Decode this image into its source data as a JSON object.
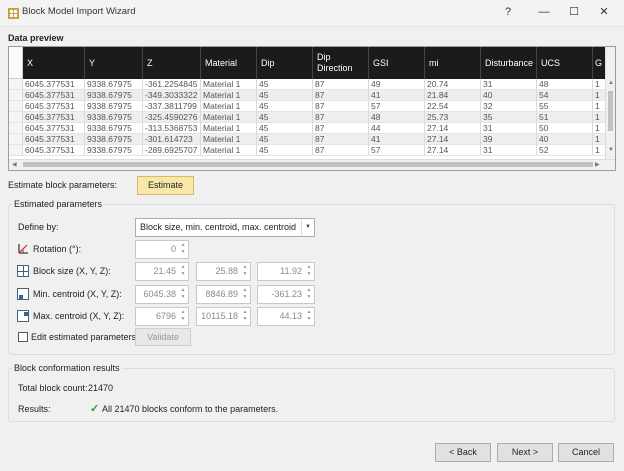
{
  "window": {
    "title": "Block Model Import Wizard",
    "help_btn": "?",
    "min_btn": "—",
    "max_btn": "☐",
    "close_btn": "✕"
  },
  "preview": {
    "title": "Data preview",
    "columns": [
      "X",
      "Y",
      "Z",
      "Material",
      "Dip",
      "Dip Direction",
      "GSI",
      "mi",
      "Disturbance",
      "UCS",
      "G"
    ],
    "rows": [
      [
        "6045.377531",
        "9338.67975",
        "-361.2254845",
        "Material 1",
        "45",
        "87",
        "49",
        "20.74",
        "31",
        "48",
        "1"
      ],
      [
        "6045.377531",
        "9338.67975",
        "-349.3033322",
        "Material 1",
        "45",
        "87",
        "41",
        "21.84",
        "40",
        "54",
        "1"
      ],
      [
        "6045.377531",
        "9338.67975",
        "-337.3811799",
        "Material 1",
        "45",
        "87",
        "57",
        "22.54",
        "32",
        "55",
        "1"
      ],
      [
        "6045.377531",
        "9338.67975",
        "-325.4590276",
        "Material 1",
        "45",
        "87",
        "48",
        "25.73",
        "35",
        "51",
        "1"
      ],
      [
        "6045.377531",
        "9338.67975",
        "-313.5368753",
        "Material 1",
        "45",
        "87",
        "44",
        "27.14",
        "31",
        "50",
        "1"
      ],
      [
        "6045.377531",
        "9338.67975",
        "-301.614723",
        "Material 1",
        "45",
        "87",
        "41",
        "27.14",
        "39",
        "40",
        "1"
      ],
      [
        "6045.377531",
        "9338.67975",
        "-289.6925707",
        "Material 1",
        "45",
        "87",
        "57",
        "27.14",
        "31",
        "52",
        "1"
      ]
    ]
  },
  "estimate": {
    "label": "Estimate block parameters:",
    "button": "Estimate"
  },
  "params": {
    "group_title": "Estimated parameters",
    "define_label": "Define by:",
    "define_value": "Block size, min. centroid, max. centroid",
    "rotation_label": "Rotation (°):",
    "rotation_value": "0",
    "block_size_label": "Block size (X, Y, Z):",
    "block_size": [
      "21.45",
      "25.88",
      "11.92"
    ],
    "min_centroid_label": "Min. centroid (X, Y, Z):",
    "min_centroid": [
      "6045.38",
      "8846.89",
      "-361.23"
    ],
    "max_centroid_label": "Max. centroid (X, Y, Z):",
    "max_centroid": [
      "6796",
      "10115.18",
      "44.13"
    ],
    "edit_label": "Edit estimated parameters:",
    "validate_button": "Validate"
  },
  "results": {
    "group_title": "Block conformation results",
    "total_label": "Total block count:",
    "total_value": "21470",
    "results_label": "Results:",
    "results_text": "All 21470 blocks conform to the parameters.",
    "check_glyph": "✓"
  },
  "nav": {
    "back": "< Back",
    "next": "Next >",
    "cancel": "Cancel"
  },
  "colors": {
    "header_bg": "#1b1b1b",
    "check": "#2e9b3a",
    "accent": "#f7e7a8"
  }
}
